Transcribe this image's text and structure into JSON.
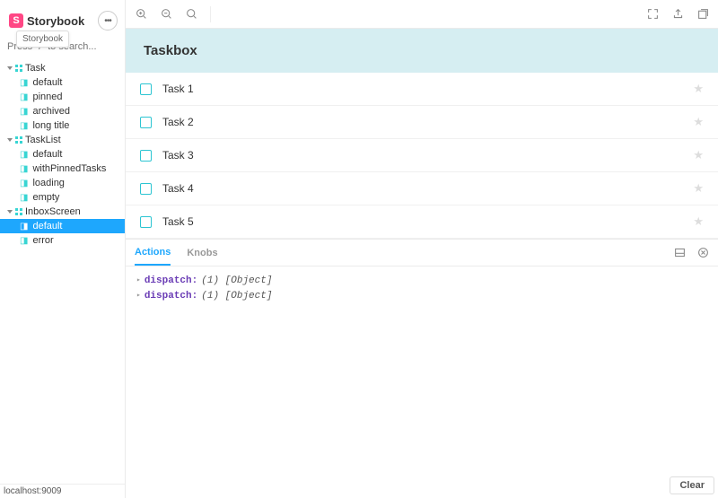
{
  "brand": "Storybook",
  "tooltip": "Storybook",
  "search": {
    "placeholder": "Press \"/\" to search..."
  },
  "tree": [
    {
      "label": "Task",
      "items": [
        "default",
        "pinned",
        "archived",
        "long title"
      ],
      "selected": null
    },
    {
      "label": "TaskList",
      "items": [
        "default",
        "withPinnedTasks",
        "loading",
        "empty"
      ],
      "selected": null
    },
    {
      "label": "InboxScreen",
      "items": [
        "default",
        "error"
      ],
      "selected": "default"
    }
  ],
  "footer": "localhost:9009",
  "canvas": {
    "header": "Taskbox",
    "tasks": [
      "Task 1",
      "Task 2",
      "Task 3",
      "Task 4",
      "Task 5"
    ]
  },
  "addons": {
    "tabs": [
      "Actions",
      "Knobs"
    ],
    "active": "Actions",
    "logs": [
      {
        "key": "dispatch:",
        "val": "(1) [Object]"
      },
      {
        "key": "dispatch:",
        "val": "(1) [Object]"
      }
    ],
    "clear": "Clear"
  }
}
